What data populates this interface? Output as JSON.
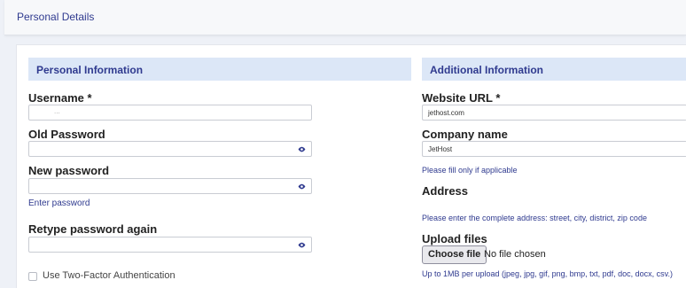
{
  "page": {
    "title": "Personal Details"
  },
  "personal": {
    "heading": "Personal Information",
    "username": {
      "label": "Username *",
      "value": "..."
    },
    "old_password": {
      "label": "Old Password",
      "value": ""
    },
    "new_password": {
      "label": "New password",
      "value": "",
      "hint": "Enter password"
    },
    "retype_password": {
      "label": "Retype password again",
      "value": ""
    },
    "two_factor": {
      "label": "Use Two-Factor Authentication",
      "checked": false
    },
    "eye_icon": "eye-icon"
  },
  "additional": {
    "heading": "Additional Information",
    "website": {
      "label": "Website URL *",
      "value": "jethost.com"
    },
    "company": {
      "label": "Company name",
      "value": "JetHost",
      "hint": "Please fill only if applicable"
    },
    "address": {
      "label": "Address",
      "hint": "Please enter the complete address: street, city, district, zip code"
    },
    "upload": {
      "label": "Upload files",
      "button": "Choose file",
      "status": "No file chosen",
      "hint": "Up to 1MB per upload (jpeg, jpg, gif, png, bmp, txt, pdf, doc, docx, csv.)"
    }
  },
  "colors": {
    "accent": "#2f3a8f",
    "section_bg": "#dce7f7",
    "page_bg": "#eef1f7"
  }
}
